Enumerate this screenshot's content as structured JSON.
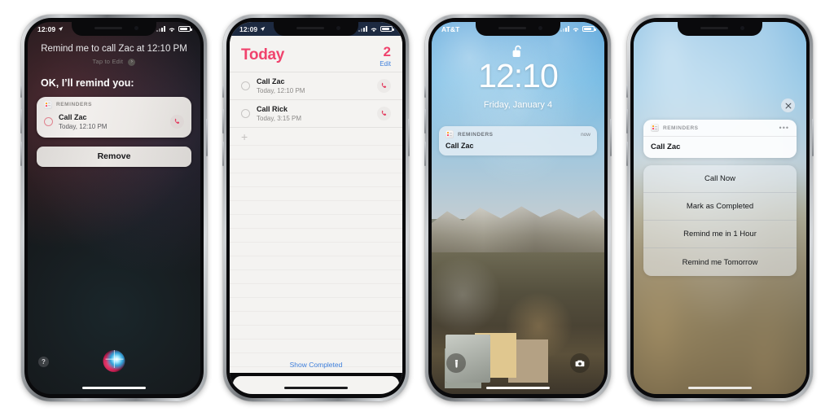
{
  "phones": [
    {
      "id": "siri",
      "name": "siri-reminder-confirmation",
      "status_bar": {
        "time": "12:09",
        "carrier": "",
        "location_icon": "location-arrow-icon",
        "signal_icon": "cellular-bars-icon",
        "wifi_icon": "wifi-icon",
        "battery_icon": "battery-icon"
      },
      "siri": {
        "query": "Remind me to call Zac at 12:10 PM",
        "tap_to_edit": "Tap to Edit",
        "tap_to_edit_chevron": "›",
        "response": "OK, I’ll remind you:",
        "card": {
          "app_label": "REMINDERS",
          "title": "Call Zac",
          "subtitle": "Today, 12:10 PM",
          "call_icon": "phone-icon",
          "checkbox_icon": "radio-circle-icon"
        },
        "remove_label": "Remove",
        "help_label": "?",
        "orb_icon": "siri-orb-icon"
      }
    },
    {
      "id": "reminders-app",
      "name": "reminders-today-list",
      "status_bar": {
        "time": "12:09",
        "location_icon": "location-arrow-icon",
        "signal_icon": "cellular-bars-icon",
        "wifi_icon": "wifi-icon",
        "battery_icon": "battery-icon"
      },
      "list": {
        "title": "Today",
        "count": "2",
        "edit_label": "Edit",
        "add_icon": "plus-icon",
        "show_completed_label": "Show Completed",
        "items": [
          {
            "title": "Call Zac",
            "subtitle": "Today, 12:10 PM",
            "call_icon": "phone-icon"
          },
          {
            "title": "Call Rick",
            "subtitle": "Today, 3:15 PM",
            "call_icon": "phone-icon"
          }
        ]
      }
    },
    {
      "id": "lock-screen",
      "name": "lock-screen-notification",
      "status_bar": {
        "carrier": "AT&T",
        "signal_icon": "cellular-bars-icon",
        "wifi_icon": "wifi-icon",
        "battery_icon": "battery-icon"
      },
      "lock": {
        "lock_icon": "unlocked-padlock-icon",
        "time": "12:10",
        "date": "Friday, January 4",
        "notification": {
          "app_label": "REMINDERS",
          "timestamp": "now",
          "title": "Call Zac"
        },
        "flashlight_icon": "flashlight-icon",
        "camera_icon": "camera-icon"
      }
    },
    {
      "id": "notification-actions",
      "name": "notification-action-menu",
      "status_bar": {},
      "actions": {
        "close_icon": "close-x-icon",
        "notification": {
          "app_label": "REMINDERS",
          "more_icon": "more-dots-icon",
          "title": "Call Zac"
        },
        "items": [
          {
            "label": "Call Now"
          },
          {
            "label": "Mark as Completed"
          },
          {
            "label": "Remind me in 1 Hour"
          },
          {
            "label": "Remind me Tomorrow"
          }
        ]
      }
    }
  ],
  "colors": {
    "reminders_accent": "#f0436d",
    "link_blue": "#3e7fdc",
    "siri_card_bg": "#ece9e6"
  }
}
